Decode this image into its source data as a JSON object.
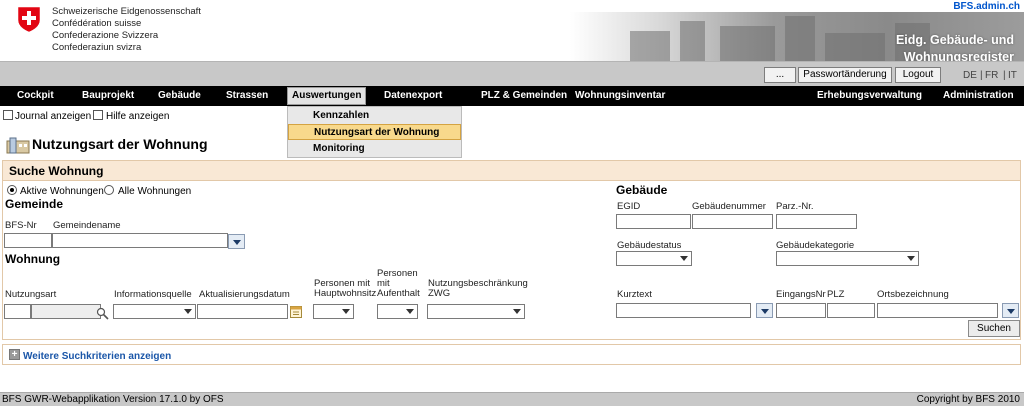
{
  "header": {
    "confederation_lines": [
      "Schweizerische Eidgenossenschaft",
      "Confédération suisse",
      "Confederazione Svizzera",
      "Confederaziun svizra"
    ],
    "site_link": "BFS.admin.ch",
    "register_title_line1": "Eidg. Gebäude- und",
    "register_title_line2": "Wohnungsregister"
  },
  "toolbar": {
    "dots_label": "...",
    "password_label": "Passwortänderung",
    "logout_label": "Logout",
    "languages": [
      "DE",
      "FR",
      "IT"
    ]
  },
  "nav": {
    "items": [
      "Cockpit",
      "Bauprojekt",
      "Gebäude",
      "Strassen",
      "Auswertungen",
      "Datenexport",
      "PLZ & Gemeinden",
      "Wohnungsinventar",
      "Erhebungsverwaltung",
      "Administration"
    ],
    "active": "Auswertungen"
  },
  "dropdown": {
    "items": [
      "Kennzahlen",
      "Nutzungsart der Wohnung",
      "Monitoring"
    ],
    "selected": "Nutzungsart der Wohnung"
  },
  "options": {
    "journal_label": "Journal anzeigen",
    "help_label": "Hilfe anzeigen"
  },
  "page": {
    "title": "Nutzungsart der Wohnung"
  },
  "search": {
    "panel_title": "Suche Wohnung",
    "radio_active": "Aktive Wohnungen",
    "radio_all": "Alle Wohnungen",
    "gemeinde_heading": "Gemeinde",
    "bfs_nr_label": "BFS-Nr",
    "gemeindename_label": "Gemeindename",
    "wohnung_heading": "Wohnung",
    "nutzungsart_label": "Nutzungsart",
    "informationsquelle_label": "Informationsquelle",
    "aktualisierungsdatum_label": "Aktualisierungsdatum",
    "personen_haupt_label_1": "Personen mit",
    "personen_haupt_label_2": "Hauptwohnsitz",
    "personen_aufenthalt_label_1": "Personen",
    "personen_aufenthalt_label_2": "mit",
    "personen_aufenthalt_label_3": "Aufenthalt",
    "nutzungsbeschraenkung_label_1": "Nutzungsbeschränkung",
    "nutzungsbeschraenkung_label_2": "ZWG",
    "gebaeude_heading": "Gebäude",
    "egid_label": "EGID",
    "gebaeudenummer_label": "Gebäudenummer",
    "parz_label": "Parz.-Nr.",
    "gebaeudestatus_label": "Gebäudestatus",
    "gebaeudekategorie_label": "Gebäudekategorie",
    "kurztext_label": "Kurztext",
    "eingangsnr_label": "EingangsNr",
    "plz_label": "PLZ",
    "ortsbezeichnung_label": "Ortsbezeichnung",
    "search_button": "Suchen"
  },
  "more": {
    "label": "Weitere Suchkriterien anzeigen"
  },
  "footer": {
    "left": "BFS GWR-Webapplikation Version 17.1.0 by OFS",
    "right": "Copyright by BFS 2010"
  },
  "colors": {
    "nav_bg": "#000000",
    "panel_header_bg": "#f9e8d5",
    "menu_selected_bg": "#f8d98c",
    "link_blue": "#1a56a8",
    "swiss_red": "#e20613"
  }
}
